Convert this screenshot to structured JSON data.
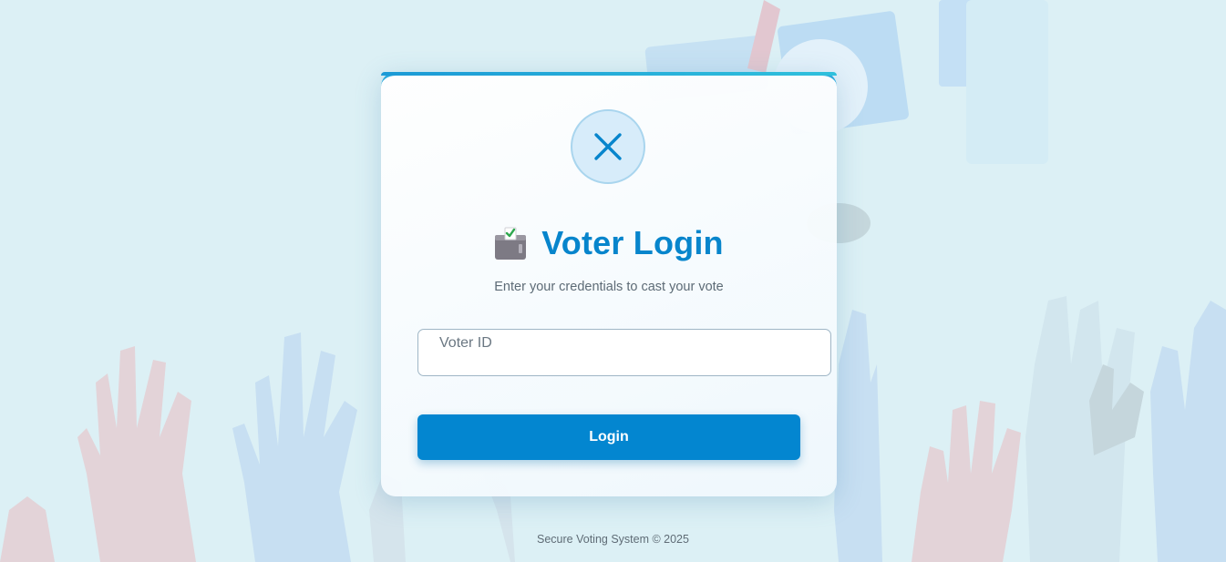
{
  "header": {
    "title": "Voter Login",
    "subtitle": "Enter your credentials to cast your vote",
    "title_icon": "ballot-box-icon",
    "close_icon": "close-icon"
  },
  "form": {
    "voter_id_placeholder": "Voter ID",
    "voter_id_value": "",
    "login_label": "Login"
  },
  "footer": {
    "text": "Secure Voting System © 2025"
  },
  "colors": {
    "accent": "#0386d0",
    "title": "#0785cc",
    "background": "#dcf0f5"
  }
}
